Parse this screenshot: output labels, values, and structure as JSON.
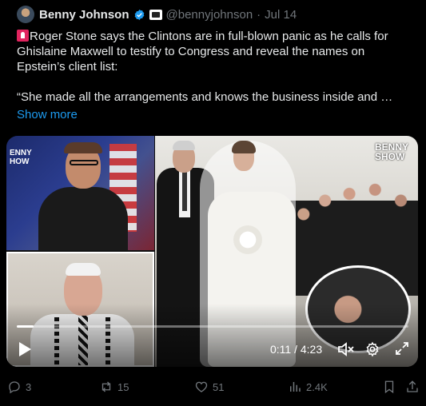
{
  "author": {
    "name": "Benny Johnson",
    "handle": "@bennyjohnson",
    "separator": "·",
    "date": "Jul 14"
  },
  "post": {
    "line1": "Roger Stone says the Clintons are in full-blown panic as he calls for Ghislaine Maxwell to testify to Congress and reveal the names on Epstein’s client list:",
    "line2": "“She made all the arrangements and knows the business inside and …",
    "show_more": "Show more"
  },
  "media": {
    "logo_left": "ENNY\nHOW",
    "logo_right": "BENNY\nSHOW",
    "time": "0:11 / 4:23",
    "progress": 0.042
  },
  "actions": {
    "replies": "3",
    "reposts": "15",
    "likes": "51",
    "views": "2.4K"
  },
  "colors": {
    "background": "#000000",
    "text": "#e7e9ea",
    "muted": "#71767b",
    "accent": "#1d9bf0",
    "verified": "#1d9bf0"
  },
  "icons": [
    "verified-badge-icon",
    "affiliate-badge-icon",
    "siren-emoji-icon",
    "play-icon",
    "volume-muted-icon",
    "settings-gear-icon",
    "fullscreen-icon",
    "reply-icon",
    "repost-icon",
    "like-icon",
    "views-icon",
    "bookmark-icon",
    "share-icon"
  ]
}
